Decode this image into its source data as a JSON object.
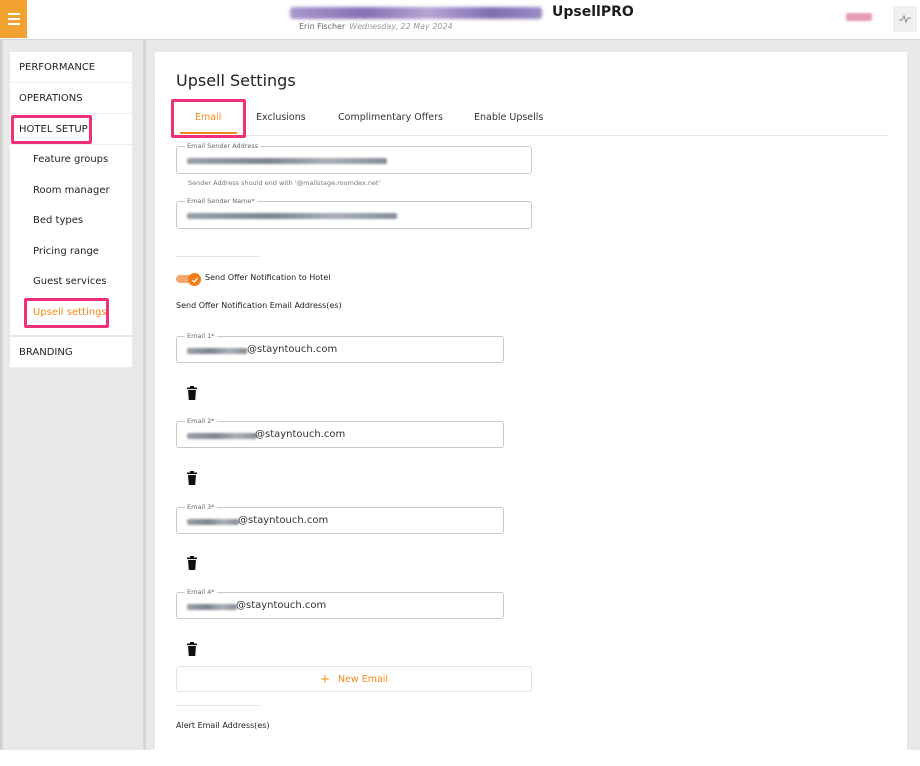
{
  "header": {
    "app_name": "UpsellPRO",
    "user_name": "Erin Fischer",
    "date": "Wednesday, 22 May 2024"
  },
  "sidebar": {
    "performance": "PERFORMANCE",
    "operations": "OPERATIONS",
    "hotel_setup": "HOTEL SETUP",
    "sub_items": [
      {
        "label": "Feature groups"
      },
      {
        "label": "Room manager"
      },
      {
        "label": "Bed types"
      },
      {
        "label": "Pricing range"
      },
      {
        "label": "Guest services"
      },
      {
        "label": "Upsell settings"
      }
    ],
    "branding": "BRANDING"
  },
  "main": {
    "title": "Upsell Settings",
    "tabs": [
      {
        "label": "Email"
      },
      {
        "label": "Exclusions"
      },
      {
        "label": "Complimentary Offers"
      },
      {
        "label": "Enable Upsells"
      }
    ],
    "sender_address": {
      "label": "Email Sender Address",
      "helper": "Sender Address should end with '@mailstage.roomdex.net'"
    },
    "sender_name": {
      "label": "Email Sender Name*"
    },
    "toggle": {
      "label": "Send Offer Notification to Hotel",
      "checked": true
    },
    "notification_section_label": "Send Offer Notification Email Address(es)",
    "emails": [
      {
        "label": "Email 1*",
        "domain": "@stayntouch.com"
      },
      {
        "label": "Email 2*",
        "domain": "@stayntouch.com"
      },
      {
        "label": "Email 3*",
        "domain": "@stayntouch.com"
      },
      {
        "label": "Email 4*",
        "domain": "@stayntouch.com"
      }
    ],
    "new_email_label": "New Email",
    "alert_section_label": "Alert Email Address(es)"
  },
  "colors": {
    "accent": "#f08a1c",
    "highlight": "#ee2f7a",
    "menu_button": "#f2a230"
  }
}
